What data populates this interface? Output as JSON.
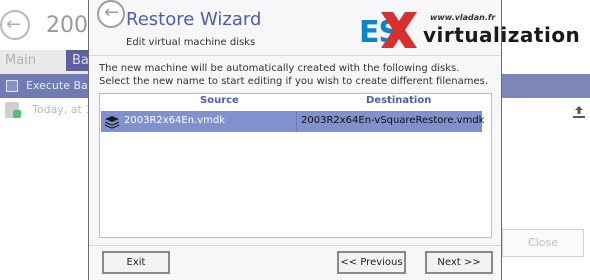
{
  "background_window": {
    "title": "2003",
    "tabs": [
      {
        "label": "Main"
      },
      {
        "label": "Bac"
      }
    ],
    "execute_label": "Execute Bac",
    "backup_item": "Today, at 10:",
    "close_label": "Close"
  },
  "dialog": {
    "title": "Restore Wizard",
    "subtitle": "Edit virtual machine disks",
    "description_line1": "The new machine will be automatically created with the following disks.",
    "description_line2": "Select the new name to start editing if you wish to create different filenames.",
    "columns": {
      "source": "Source",
      "destination": "Destination"
    },
    "disks": [
      {
        "source": "2003R2x64En.vmdk",
        "destination": "2003R2x64En-vSquareRestore.vmdk",
        "selected": true
      }
    ],
    "buttons": {
      "exit": "Exit",
      "previous": "<< Previous",
      "next": "Next >>"
    }
  },
  "watermark": {
    "url": "www.vladan.fr",
    "brand_prefix": "ES",
    "brand_suffix": "virtualization",
    "colors": {
      "blue": "#0d86c7",
      "red": "#d8302f"
    }
  }
}
